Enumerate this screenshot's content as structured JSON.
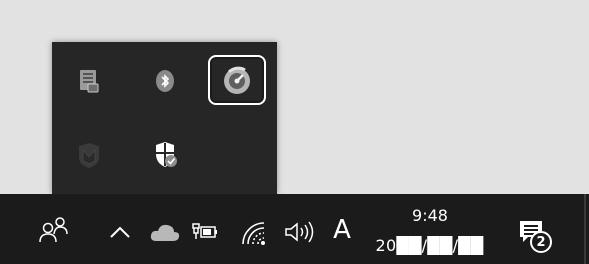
{
  "colors": {
    "desktop": "#e2e2e2",
    "taskbar": "#1b1b1b",
    "overflow_panel": "#262626",
    "text": "#ffffff"
  },
  "overflow_tray": {
    "icons": [
      "network-monitor-app-icon",
      "bluetooth-icon",
      "dial-app-icon",
      "antivirus-shield-icon",
      "windows-security-icon"
    ],
    "highlighted_icon": "dial-app-icon"
  },
  "taskbar": {
    "icons": [
      "people-icon",
      "show-hidden-icons-chevron",
      "onedrive-cloud-icon",
      "battery-charging-icon",
      "wifi-icon",
      "volume-icon",
      "ime-indicator",
      "clock",
      "notification-center-icon"
    ],
    "ime_indicator": "A",
    "clock": {
      "time": "9:48",
      "date": "20██/██/██"
    },
    "notifications_count": "2"
  }
}
